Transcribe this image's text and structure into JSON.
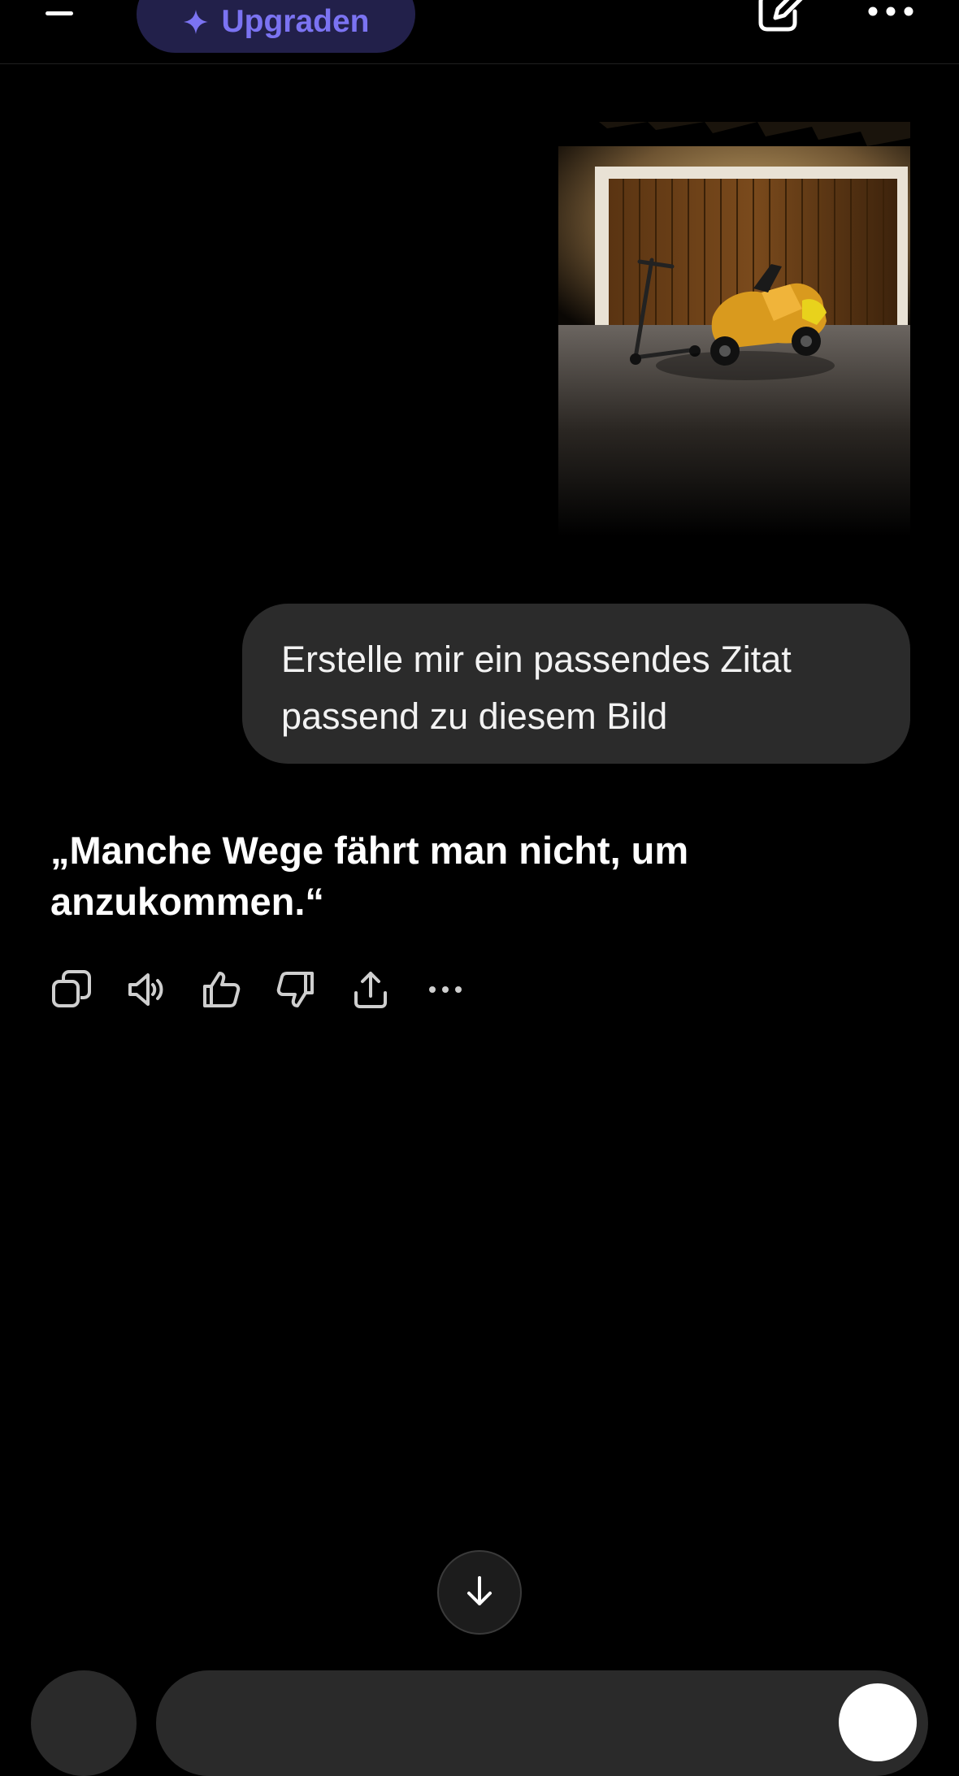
{
  "header": {
    "menu_icon": "hamburger-menu-icon",
    "upgrade_label": "Upgraden",
    "upgrade_icon": "sparkle-icon",
    "compose_icon": "new-chat-icon",
    "more_icon": "more-icon"
  },
  "conversation": {
    "user_image_alt": "",
    "user_message": "Erstelle mir ein passendes Zitat passend zu diesem Bild",
    "assistant_message": "„Manche Wege fährt man nicht, um anzukommen.“",
    "actions": [
      "copy-icon",
      "read-aloud-icon",
      "thumbs-up-icon",
      "thumbs-down-icon",
      "share-icon",
      "more-icon"
    ]
  },
  "footer": {
    "scroll_down_icon": "arrow-down-icon"
  },
  "colors": {
    "background": "#000000",
    "bubble": "#2b2b2b",
    "accent": "#7b73f2",
    "upgrade_bg": "#22204a"
  }
}
